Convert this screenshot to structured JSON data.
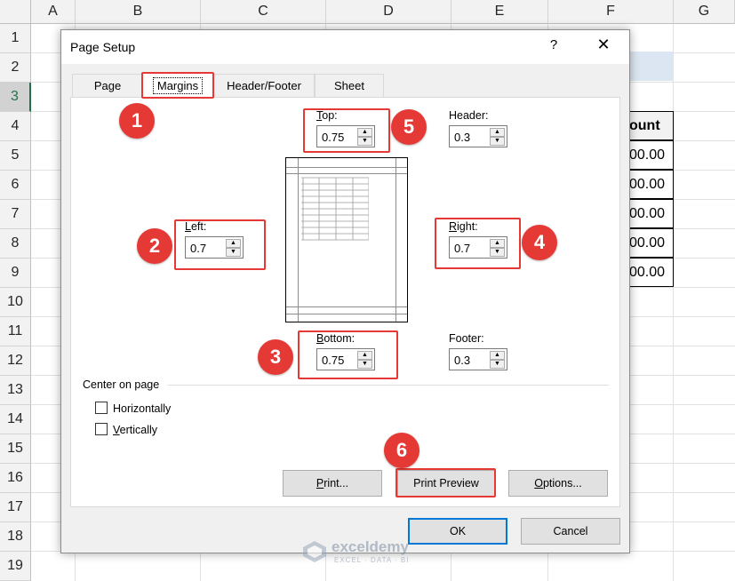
{
  "spreadsheet": {
    "columns": [
      "A",
      "B",
      "C",
      "D",
      "E",
      "F",
      "G"
    ],
    "rows": [
      "1",
      "2",
      "3",
      "4",
      "5",
      "6",
      "7",
      "8",
      "9",
      "10",
      "11",
      "12",
      "13",
      "14",
      "15",
      "16",
      "17",
      "18",
      "19"
    ],
    "active_row": "3",
    "visible_cells": [
      "ount",
      "00.00",
      "00.00",
      "00.00",
      "00.00",
      "00.00"
    ]
  },
  "dialog": {
    "title": "Page Setup",
    "help": "?",
    "close": "✕",
    "tabs": [
      "Page",
      "Margins",
      "Header/Footer",
      "Sheet"
    ],
    "selected_tab": "Margins",
    "top": {
      "label_u": "T",
      "label_rest": "op:",
      "value": "0.75"
    },
    "header": {
      "label": "Header:",
      "value": "0.3"
    },
    "left": {
      "label_u": "L",
      "label_rest": "eft:",
      "value": "0.7"
    },
    "right": {
      "label_u": "R",
      "label_rest": "ight:",
      "value": "0.7"
    },
    "bottom": {
      "label_u": "B",
      "label_rest": "ottom:",
      "value": "0.75"
    },
    "footer": {
      "label": "Footer:",
      "value": "0.3"
    },
    "center_on_page": "Center on page",
    "horizontally": {
      "label_u": "",
      "label": "Horizontally",
      "checked": false
    },
    "vertically": {
      "label_u": "V",
      "label_rest": "ertically",
      "checked": false
    },
    "buttons": {
      "print_u": "P",
      "print_rest": "rint...",
      "print_preview": "Print Preview",
      "options_u": "O",
      "options_rest": "ptions...",
      "ok": "OK",
      "cancel": "Cancel"
    }
  },
  "callouts": [
    "1",
    "2",
    "3",
    "4",
    "5",
    "6"
  ],
  "watermark": {
    "name": "exceldemy",
    "tagline": "EXCEL · DATA · BI"
  },
  "colors": {
    "callout": "#e53935",
    "accent": "#0078d7",
    "excel_green": "#217346"
  }
}
